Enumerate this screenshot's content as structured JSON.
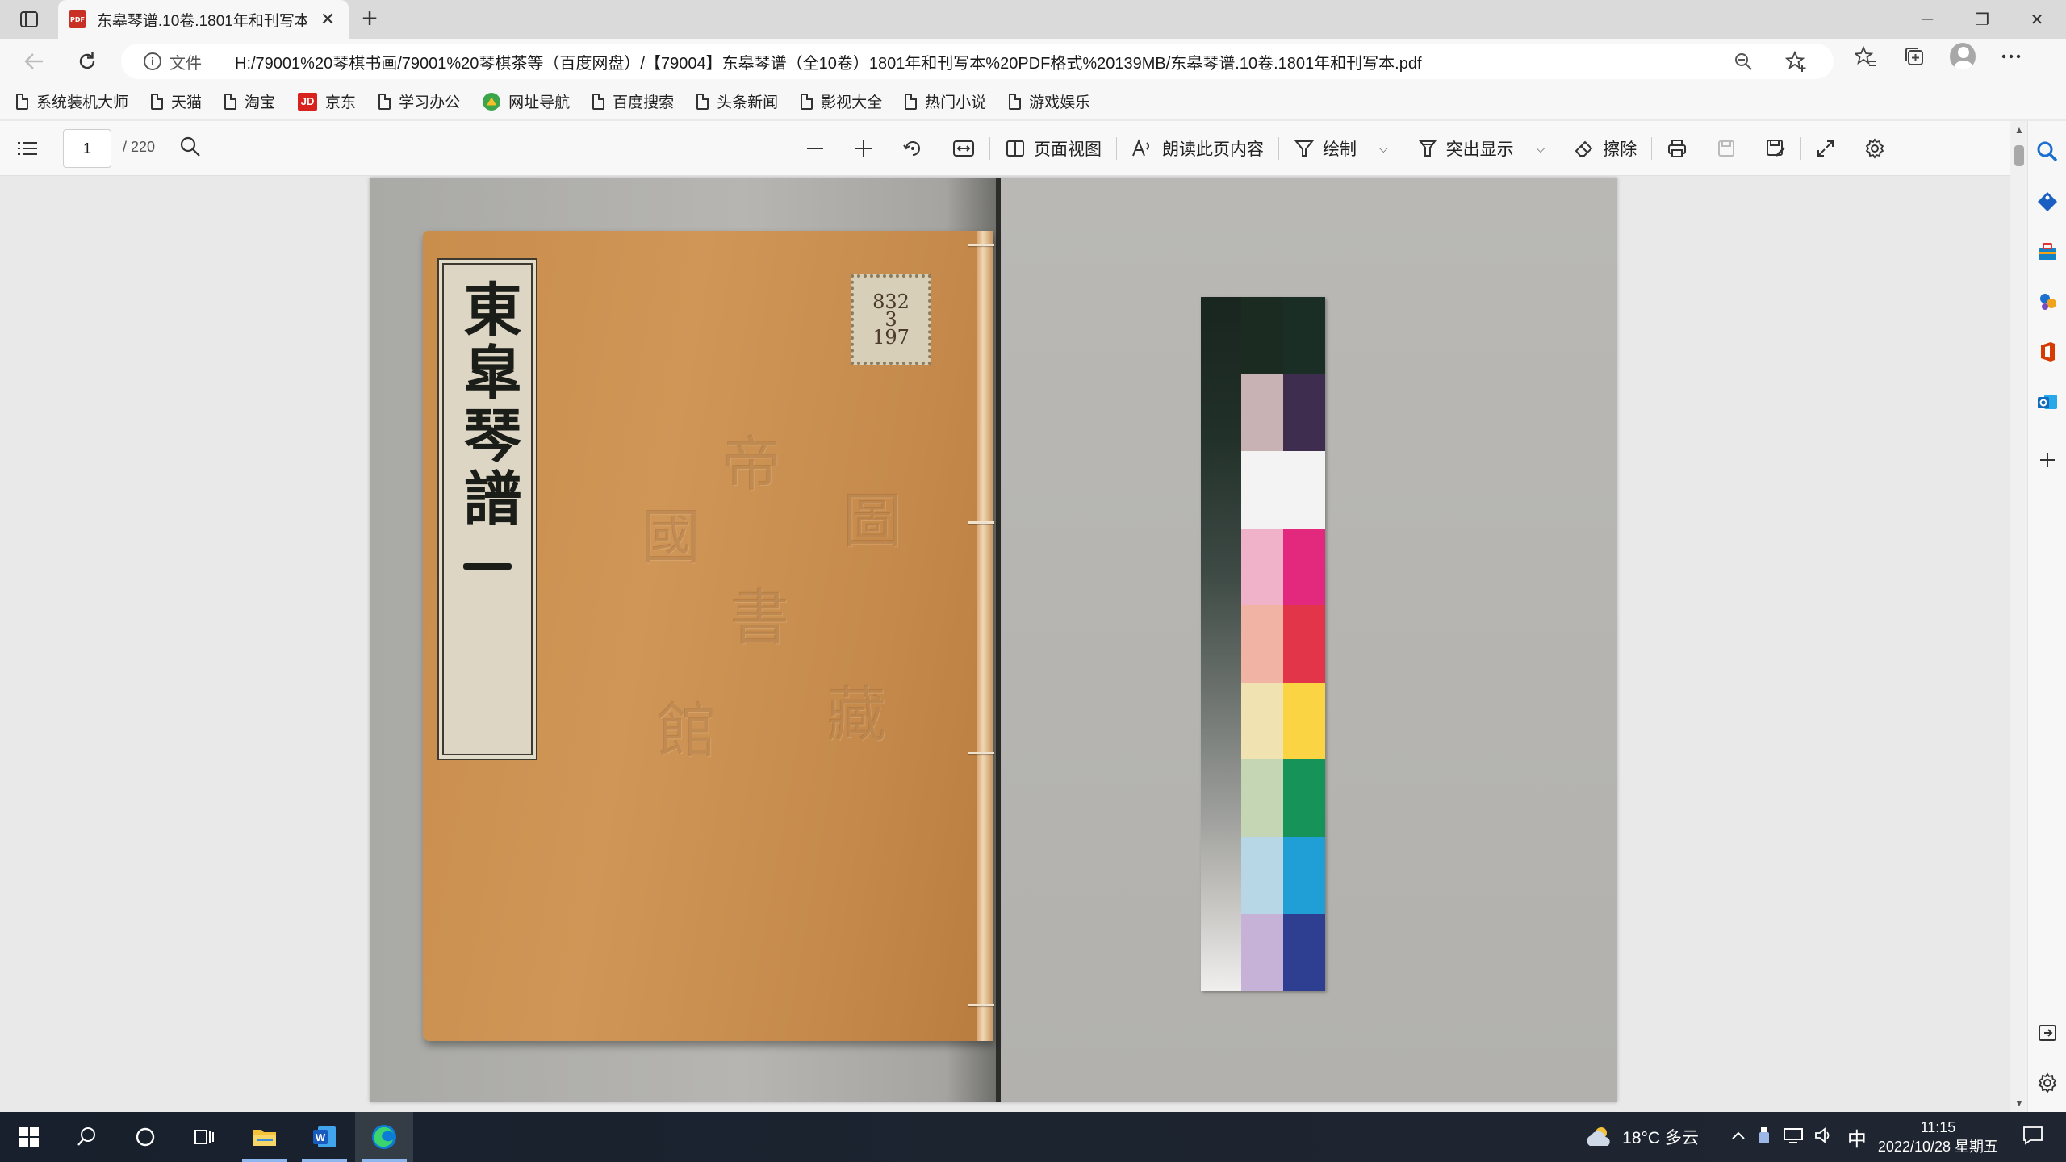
{
  "browser": {
    "tab": {
      "title": "东皋琴谱.10卷.1801年和刊写本.pdf",
      "close": "✕",
      "icon_label": "PDF"
    },
    "new_tab": "+",
    "window_controls": {
      "minimize": "─",
      "restore": "❐",
      "close": "✕"
    },
    "address": {
      "scheme_label": "文件",
      "url": "H:/79001%20琴棋书画/79001%20琴棋茶等（百度网盘）/【79004】东皋琴谱（全10卷）1801年和刊写本%20PDF格式%20139MB/东皋琴谱.10卷.1801年和刊写本.pdf"
    },
    "bookmarks": [
      {
        "label": "系统装机大师",
        "icon": "page-icon"
      },
      {
        "label": "天猫",
        "icon": "page-icon"
      },
      {
        "label": "淘宝",
        "icon": "page-icon"
      },
      {
        "label": "京东",
        "icon": "jd-icon",
        "icon_text": "JD"
      },
      {
        "label": "学习办公",
        "icon": "page-icon"
      },
      {
        "label": "网址导航",
        "icon": "nav-icon"
      },
      {
        "label": "百度搜索",
        "icon": "page-icon"
      },
      {
        "label": "头条新闻",
        "icon": "page-icon"
      },
      {
        "label": "影视大全",
        "icon": "page-icon"
      },
      {
        "label": "热门小说",
        "icon": "page-icon"
      },
      {
        "label": "游戏娱乐",
        "icon": "page-icon"
      }
    ]
  },
  "pdf_toolbar": {
    "page_current": "1",
    "page_total": "/ 220",
    "page_view": "页面视图",
    "read_aloud": "朗读此页内容",
    "draw": "绘制",
    "highlight": "突出显示",
    "erase": "擦除"
  },
  "document": {
    "book_title": "東皐琴譜",
    "stamp_lines": [
      "832",
      "3",
      "197"
    ],
    "emboss": [
      "帝",
      "國",
      "圖",
      "書",
      "館",
      "藏"
    ],
    "color_chart": {
      "left_column": [
        "#1b2b22",
        "#c8b2b4",
        "#f3f3f3",
        "#f0b2c8",
        "#f1b3a3",
        "#f1e2b2",
        "#c4d6b3",
        "#b8d7e6",
        "#c5b2d6"
      ],
      "right_column": [
        "#1a2e25",
        "#3f2d4f",
        "#f3f3f3",
        "#e2297e",
        "#e33549",
        "#fbd444",
        "#159358",
        "#1f9fd6",
        "#2e3f92"
      ],
      "top_cells": [
        "#c8c2c0",
        "#c7b0b0"
      ]
    }
  },
  "taskbar": {
    "weather": "18°C  多云",
    "ime": "中",
    "time": "11:15",
    "date": "2022/10/28 星期五"
  },
  "colors": {
    "accent": "#0f6cbd",
    "edge_blue": "#0c7dd6",
    "pdf_red": "#c83025"
  }
}
